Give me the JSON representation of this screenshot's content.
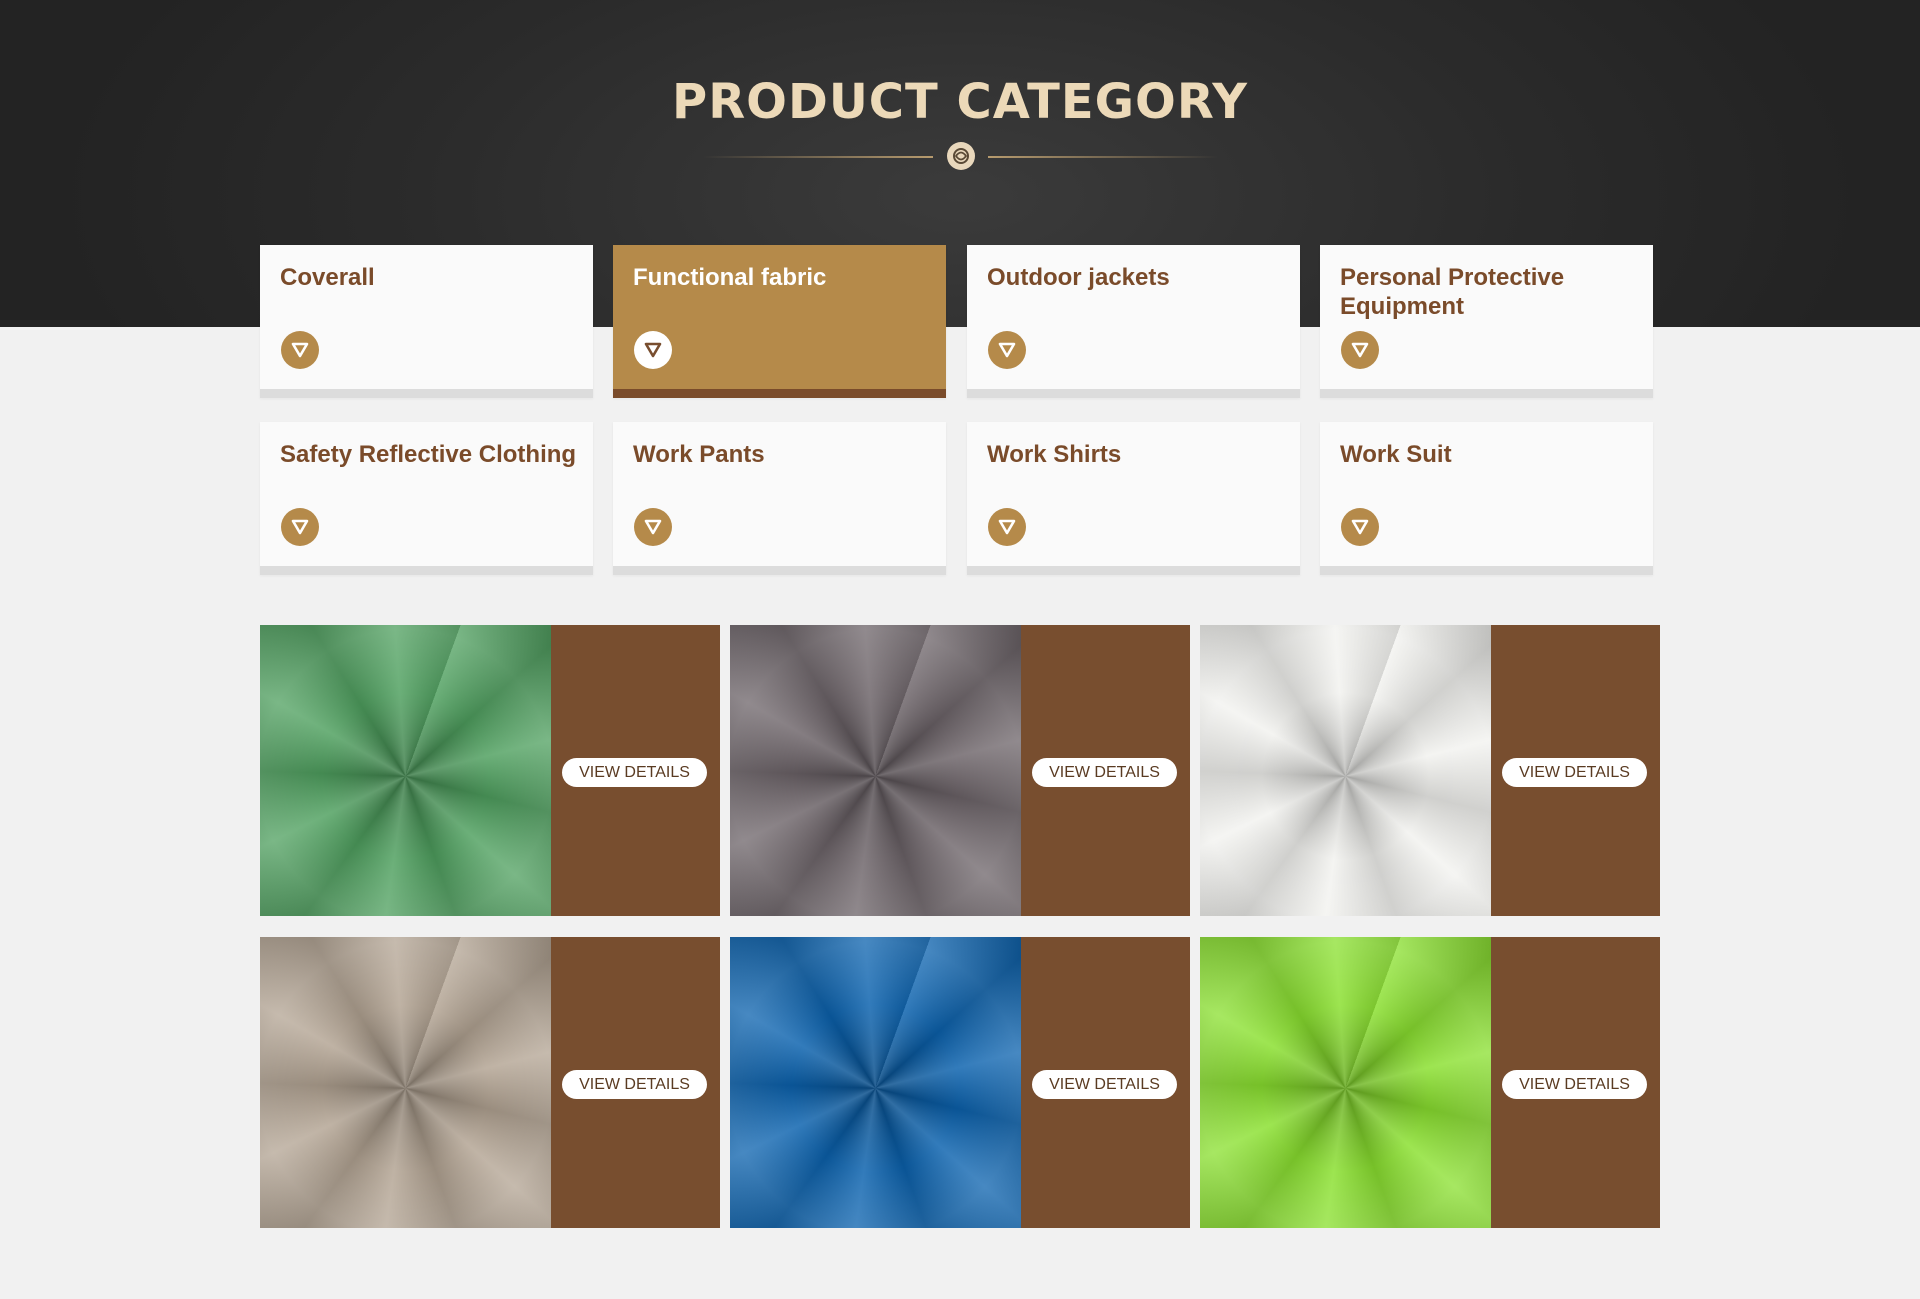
{
  "header": {
    "title": "PRODUCT CATEGORY"
  },
  "categories": [
    {
      "label": "Coverall",
      "active": false
    },
    {
      "label": "Functional fabric",
      "active": true
    },
    {
      "label": "Outdoor jackets",
      "active": false
    },
    {
      "label": "Personal Protective Equipment",
      "active": false
    },
    {
      "label": "Safety Reflective Clothing",
      "active": false
    },
    {
      "label": "Work Pants",
      "active": false
    },
    {
      "label": "Work Shirts",
      "active": false
    },
    {
      "label": "Work Suit",
      "active": false
    }
  ],
  "products": [
    {
      "color": "#4fa05f",
      "button": "VIEW DETAILS"
    },
    {
      "color": "#6d6469",
      "button": "VIEW DETAILS"
    },
    {
      "color": "#f2f2ef",
      "button": "VIEW DETAILS"
    },
    {
      "color": "#b3a493",
      "button": "VIEW DETAILS"
    },
    {
      "color": "#0b62ae",
      "button": "VIEW DETAILS"
    },
    {
      "color": "#8ae02f",
      "button": "VIEW DETAILS"
    }
  ],
  "colors": {
    "accent": "#b58a4a",
    "brown": "#784e2f",
    "title": "#ecd9b8"
  }
}
